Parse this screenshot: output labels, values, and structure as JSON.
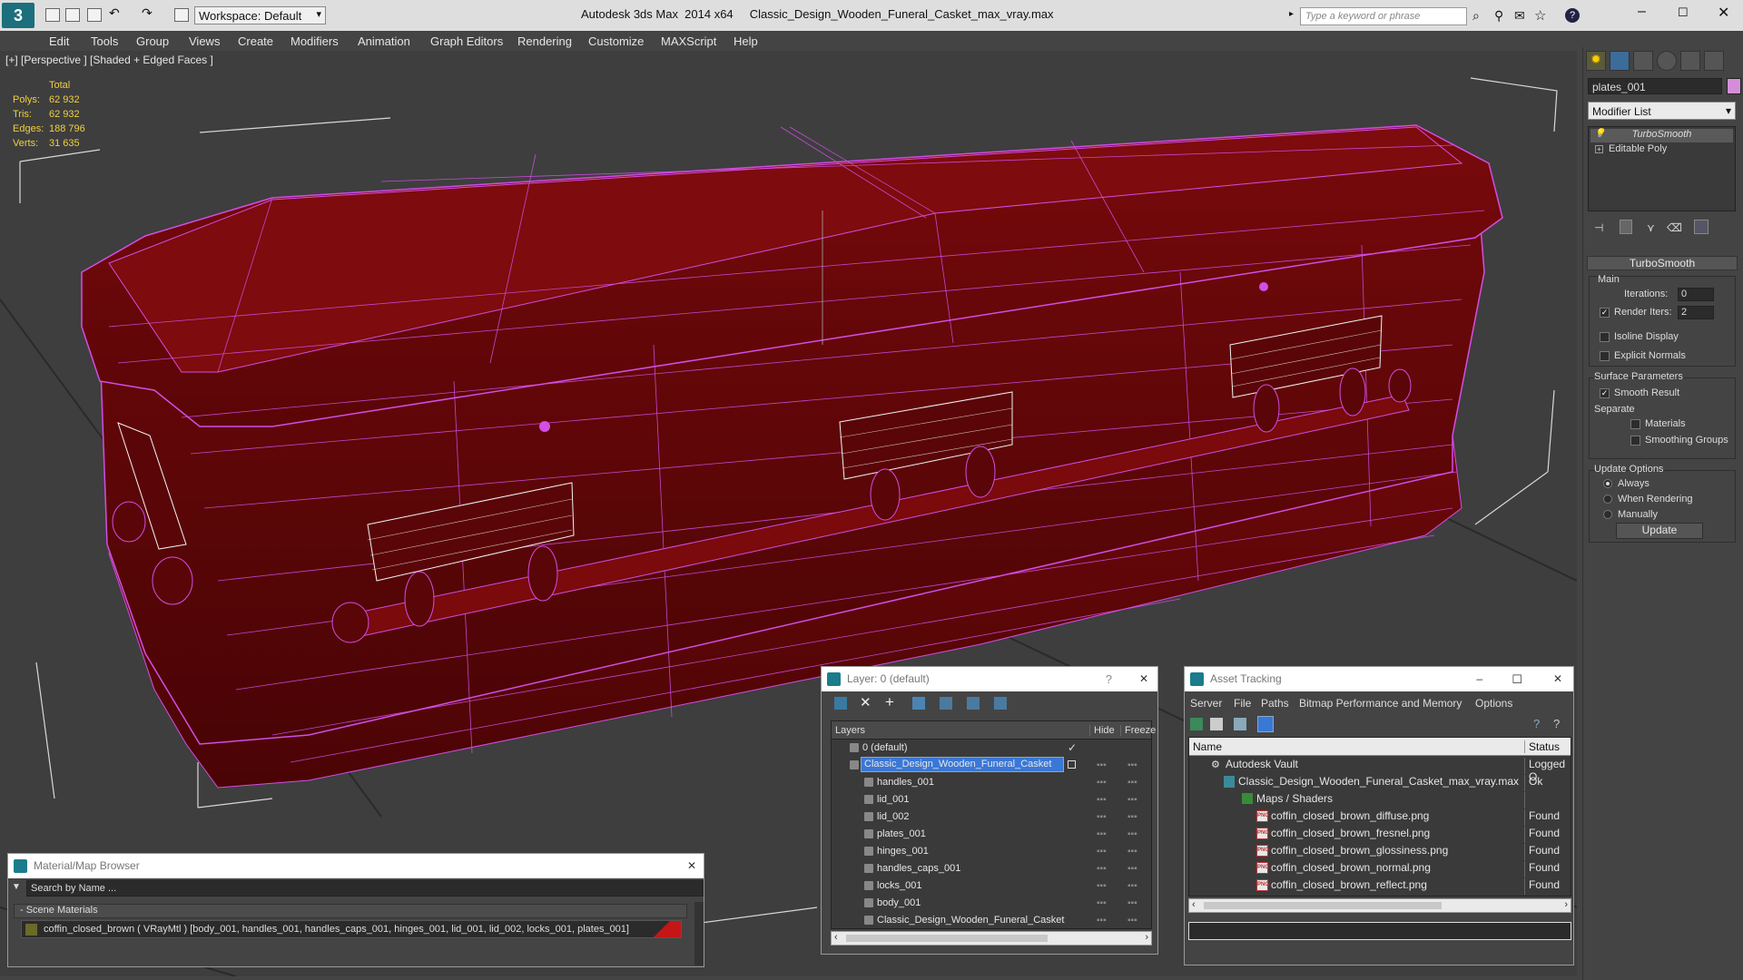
{
  "titlebar": {
    "app_title": "Autodesk 3ds Max  2014 x64",
    "file_title": "Classic_Design_Wooden_Funeral_Casket_max_vray.max",
    "workspace": "Workspace: Default",
    "search_placeholder": "Type a keyword or phrase"
  },
  "menu": [
    "Edit",
    "Tools",
    "Group",
    "Views",
    "Create",
    "Modifiers",
    "Animation",
    "Graph Editors",
    "Rendering",
    "Customize",
    "MAXScript",
    "Help"
  ],
  "viewport": {
    "label": "[+] [Perspective ] [Shaded + Edged Faces ]",
    "stats": {
      "header": "Total",
      "polys_label": "Polys:",
      "polys": "62 932",
      "tris_label": "Tris:",
      "tris": "62 932",
      "edges_label": "Edges:",
      "edges": "188 796",
      "verts_label": "Verts:",
      "verts": "31 635"
    },
    "wire_color": "#d24ee6",
    "wood_color": "#6a0608"
  },
  "command_panel": {
    "object_name": "plates_001",
    "modifier_list": "Modifier List",
    "stack": [
      "TurboSmooth",
      "Editable Poly"
    ],
    "rollout_title": "TurboSmooth",
    "main_label": "Main",
    "iterations_label": "Iterations:",
    "iterations": "0",
    "render_iters_label": "Render Iters:",
    "render_iters": "2",
    "isoline": "Isoline Display",
    "explicit_normals": "Explicit Normals",
    "surface_params": "Surface Parameters",
    "smooth_result": "Smooth Result",
    "separate": "Separate",
    "materials": "Materials",
    "smoothing_groups": "Smoothing Groups",
    "update_options": "Update Options",
    "always": "Always",
    "when_rendering": "When Rendering",
    "manually": "Manually",
    "update_button": "Update"
  },
  "material_browser": {
    "title": "Material/Map Browser",
    "search_placeholder": "Search by Name ...",
    "section": "- Scene Materials",
    "material": "coffin_closed_brown  ( VRayMtl ) [body_001, handles_001, handles_caps_001, hinges_001, lid_001, lid_002, locks_001, plates_001]"
  },
  "layer_window": {
    "title": "Layer: 0 (default)",
    "help": "?",
    "col_layers": "Layers",
    "col_hide": "Hide",
    "col_freeze": "Freeze",
    "rows": [
      {
        "name": "0 (default)",
        "level": 1
      },
      {
        "name": "Classic_Design_Wooden_Funeral_Casket",
        "level": 1
      },
      {
        "name": "handles_001",
        "level": 2
      },
      {
        "name": "lid_001",
        "level": 2
      },
      {
        "name": "lid_002",
        "level": 2
      },
      {
        "name": "plates_001",
        "level": 2
      },
      {
        "name": "hinges_001",
        "level": 2
      },
      {
        "name": "handles_caps_001",
        "level": 2
      },
      {
        "name": "locks_001",
        "level": 2
      },
      {
        "name": "body_001",
        "level": 2
      },
      {
        "name": "Classic_Design_Wooden_Funeral_Casket",
        "level": 2
      }
    ]
  },
  "asset_tracking": {
    "title": "Asset Tracking",
    "menu": [
      "Server",
      "File",
      "Paths",
      "Bitmap Performance and Memory",
      "Options"
    ],
    "col_name": "Name",
    "col_status": "Status",
    "rows": [
      {
        "name": "Autodesk Vault",
        "status": "Logged O"
      },
      {
        "name": "Classic_Design_Wooden_Funeral_Casket_max_vray.max",
        "status": "Ok"
      },
      {
        "name": "Maps / Shaders",
        "status": ""
      },
      {
        "name": "coffin_closed_brown_diffuse.png",
        "status": "Found"
      },
      {
        "name": "coffin_closed_brown_fresnel.png",
        "status": "Found"
      },
      {
        "name": "coffin_closed_brown_glossiness.png",
        "status": "Found"
      },
      {
        "name": "coffin_closed_brown_normal.png",
        "status": "Found"
      },
      {
        "name": "coffin_closed_brown_reflect.png",
        "status": "Found"
      }
    ]
  }
}
